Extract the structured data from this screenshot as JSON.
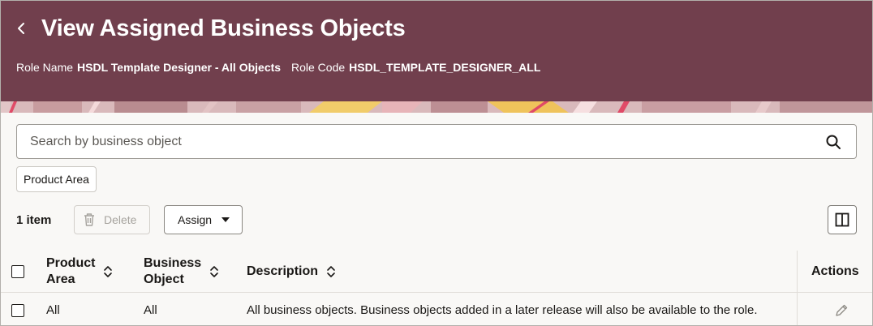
{
  "header": {
    "title": "View Assigned Business Objects",
    "role_name_label": "Role Name",
    "role_name_value": "HSDL Template Designer - All Objects",
    "role_code_label": "Role Code",
    "role_code_value": "HSDL_TEMPLATE_DESIGNER_ALL",
    "bg_color": "#713f4d"
  },
  "search": {
    "placeholder": "Search by business object"
  },
  "filters": {
    "chip_label": "Product Area"
  },
  "toolbar": {
    "count": "1 item",
    "delete_label": "Delete",
    "assign_label": "Assign"
  },
  "table": {
    "columns": [
      "Product\nArea",
      "Business\nObject",
      "Description",
      "Actions"
    ],
    "rows": [
      {
        "product_area": "All",
        "business_object": "All",
        "description": "All business objects. Business objects added in a later release will also be available to the role."
      }
    ]
  },
  "icons": [
    "back-icon",
    "search-icon",
    "trash-icon",
    "caret-down-icon",
    "columns-icon",
    "sort-icon",
    "edit-icon"
  ]
}
